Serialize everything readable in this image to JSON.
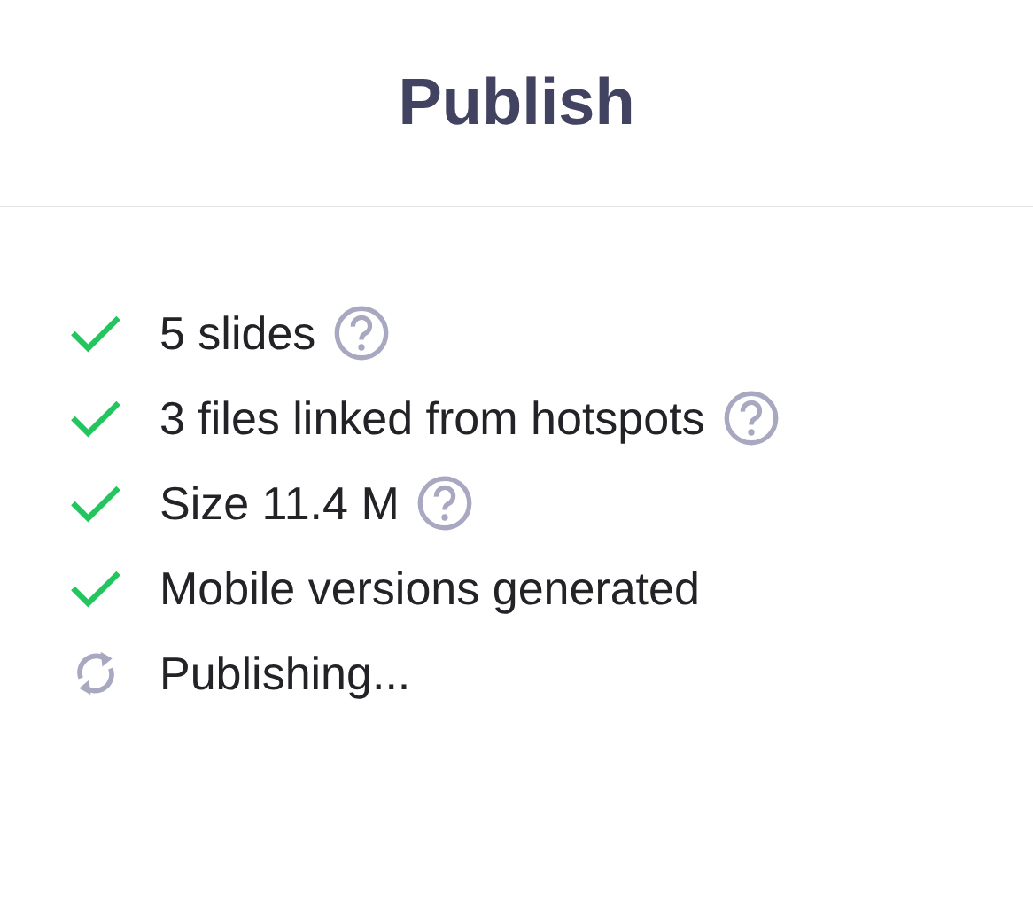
{
  "header": {
    "title": "Publish"
  },
  "steps": [
    {
      "label": "5 slides",
      "kind": "done",
      "help": true
    },
    {
      "label": "3 files linked from hotspots",
      "kind": "done",
      "help": true
    },
    {
      "label": "Size 11.4 M",
      "kind": "done",
      "help": true
    },
    {
      "label": "Mobile versions generated",
      "kind": "done",
      "help": false
    },
    {
      "label": "Publishing...",
      "kind": "pending",
      "help": false
    }
  ]
}
